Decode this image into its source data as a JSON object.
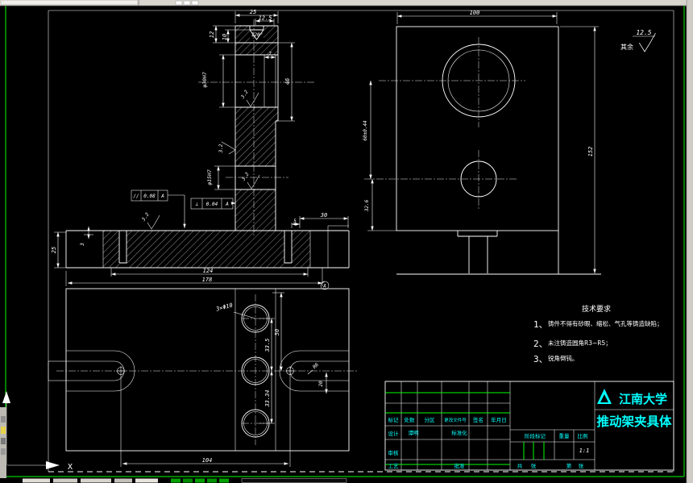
{
  "colors": {
    "background": "#000000",
    "line": "#ffffff",
    "sheet_border_green": "#00ff00",
    "titleblock_cyan": "#00ffff",
    "chrome_gray": "#d8d5ce"
  },
  "front_view": {
    "dim_width_top": "25",
    "dim_width_inner": "12.5",
    "dim_cap_h1": "12",
    "dim_cap_h2": "10",
    "angle_label": "120°",
    "dim_wall": "7",
    "dim_right_h": "46",
    "dim_bore_large": "φ30H7",
    "dim_bore_small": "φ15H7",
    "roughness_bore_large": "3.2",
    "roughness_left_face": "3.2",
    "roughness_bore_small": "3.2",
    "roughness_base_top": "3.2",
    "tol_parallel_sym": "//",
    "tol_parallel_val": "0.08",
    "tol_parallel_datum": "A",
    "tol_perp_sym": "⊥",
    "tol_perp_val": "0.04",
    "tol_perp_datum": "A",
    "dim_base_height": "25",
    "dim_base_step": "3",
    "dim_base_inner": "124",
    "dim_base_total": "178",
    "datum_label": "A",
    "dim_right_top": "30",
    "dim_right_step": "5"
  },
  "side_view": {
    "dim_width": "100",
    "dim_height": "152",
    "dim_center_dist": "60±0.44",
    "dim_bottom": "32.6",
    "roughness_general": "12.5",
    "roughness_prefix": "其余"
  },
  "plan_view": {
    "holes_label": "3×Φ10",
    "dim_top": "50",
    "dim_mid": "33.5",
    "dim_bot": "33.34",
    "dim_span": "104",
    "slot_radius": "R6",
    "slot_width": "20"
  },
  "tech_requirements": {
    "title": "技术要求",
    "items": [
      {
        "num": "1、",
        "text": "铸件不得有砂眼、缩松、气孔等铸造缺陷；"
      },
      {
        "num": "2、",
        "text": "未注铸造圆角R3~R5；"
      },
      {
        "num": "3、",
        "text": "锐角倒钝。"
      }
    ]
  },
  "title_block": {
    "labels_row": {
      "mark": "标记",
      "count": "处数",
      "zone": "分区",
      "change_doc": "更改文件号",
      "sign": "签名",
      "date": "年月日"
    },
    "design_label": "设计",
    "designer_name": "谭明",
    "standard_label": "标准化",
    "check_label": "审核",
    "process_label": "工艺",
    "approve_label": "批准",
    "stage_label": "阶段标记",
    "weight_label": "重量",
    "scale_label": "比例",
    "scale_value": "1:1",
    "sheet_total_prefix": "共",
    "sheet_total_suffix": "张",
    "sheet_num_prefix": "第",
    "sheet_num_suffix": "张",
    "university": "江南大学",
    "drawing_title": "推动架夹具体"
  },
  "ucs": {
    "x_label": "X"
  }
}
